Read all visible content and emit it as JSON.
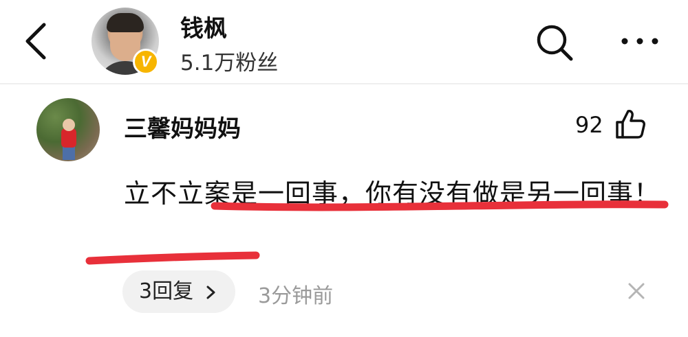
{
  "header": {
    "user_name": "钱枫",
    "follower_count": "5.1万粉丝",
    "verified_badge": "V",
    "icons": [
      "back-arrow-icon",
      "verified-badge-icon",
      "search-icon",
      "more-options-icon"
    ]
  },
  "comment": {
    "author": "三馨妈妈妈",
    "like_count": "92",
    "text": "立不立案是一回事，你有没有做是另一回事！",
    "reply_label": "3回复",
    "timestamp": "3分钟前",
    "underline_color": "#e8303a",
    "icons": [
      "thumbs-up-icon",
      "chevron-right-icon",
      "close-icon"
    ]
  }
}
